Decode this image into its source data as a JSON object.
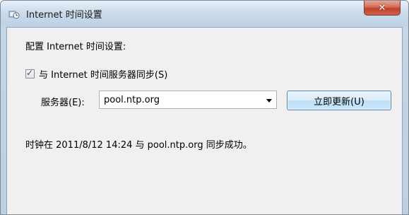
{
  "window": {
    "title": "Internet 时间设置",
    "close_symbol": "✕"
  },
  "main": {
    "heading": "配置 Internet 时间设置:",
    "sync_checkbox": {
      "label": "与 Internet 时间服务器同步(S)",
      "checked": true
    },
    "server": {
      "label": "服务器(E):",
      "value": "pool.ntp.org"
    },
    "update_button_label": "立即更新(U)",
    "status_text": "时钟在 2011/8/12 14:24 与 pool.ntp.org 同步成功。"
  },
  "colors": {
    "close_button": "#c8462f",
    "button_border": "#5c87b2",
    "client_background": "#f0f0f0"
  },
  "icons": {
    "window": "clock-network-icon",
    "close": "close-icon",
    "dropdown": "chevron-down-icon",
    "check": "check-mark-icon"
  }
}
